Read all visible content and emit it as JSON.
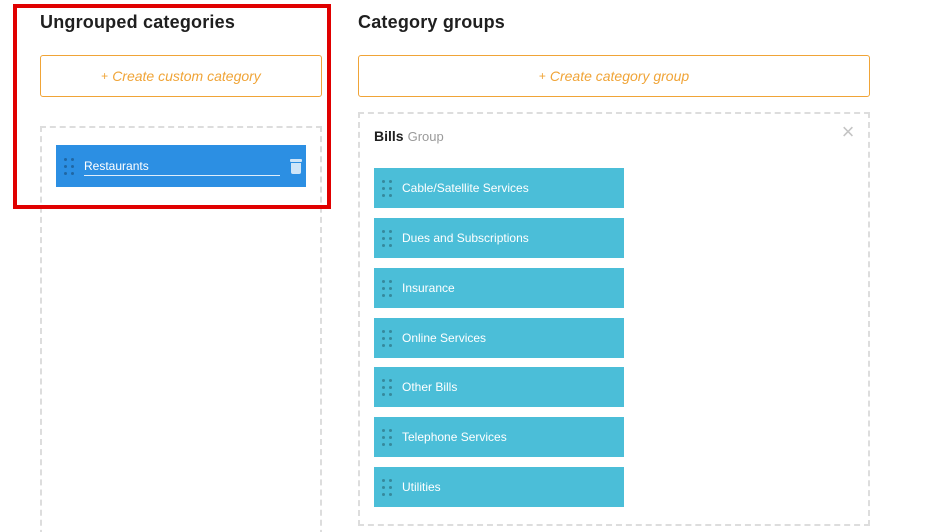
{
  "ungrouped": {
    "title": "Ungrouped categories",
    "create_label": "Create custom category",
    "items": [
      {
        "label": "Restaurants"
      }
    ]
  },
  "groups": {
    "title": "Category groups",
    "create_label": "Create category group",
    "list": [
      {
        "name": "Bills",
        "subtitle": "Group",
        "categories": [
          {
            "label": "Cable/Satellite Services"
          },
          {
            "label": "Dues and Subscriptions"
          },
          {
            "label": "Insurance"
          },
          {
            "label": "Online Services"
          },
          {
            "label": "Other Bills"
          },
          {
            "label": "Telephone Services"
          },
          {
            "label": "Utilities"
          }
        ]
      }
    ]
  },
  "colors": {
    "accent_orange": "#f0a437",
    "selected_blue": "#2c8fe3",
    "category_teal": "#4bbed8",
    "highlight_red": "#e00000"
  },
  "icons": {
    "plus": "+",
    "close": "×",
    "drag": "drag-handle-icon",
    "trash": "trash-icon"
  }
}
